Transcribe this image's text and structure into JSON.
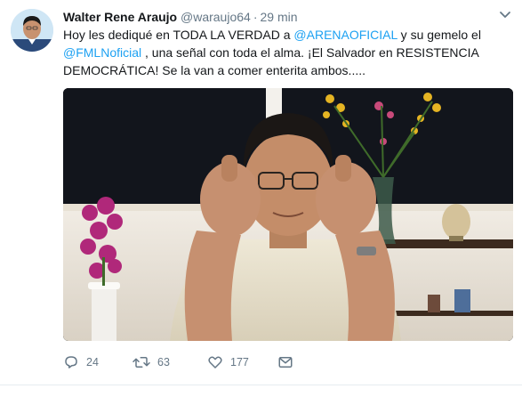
{
  "author": {
    "name": "Walter Rene Araujo",
    "handle": "@waraujo64",
    "separator": "·",
    "time": "29 min"
  },
  "tweet": {
    "text_parts": {
      "p1": "Hoy les dediqué en TODA LA VERDAD a ",
      "m1": "@ARENAOFICIAL",
      "p2": " y su gemelo el ",
      "m2": "@FMLNoficial",
      "p3": " , una señal con toda el alma. ¡El Salvador en RESISTENCIA DEMOCRÁTICA! Se la van a comer enterita ambos....."
    }
  },
  "actions": {
    "replies": "24",
    "retweets": "63",
    "likes": "177"
  },
  "colors": {
    "link": "#1da1f2",
    "secondary_text": "#657786",
    "primary_text": "#14171a"
  },
  "icons": [
    "avatar",
    "caret-down-icon",
    "reply-icon",
    "retweet-icon",
    "like-icon",
    "message-icon"
  ]
}
